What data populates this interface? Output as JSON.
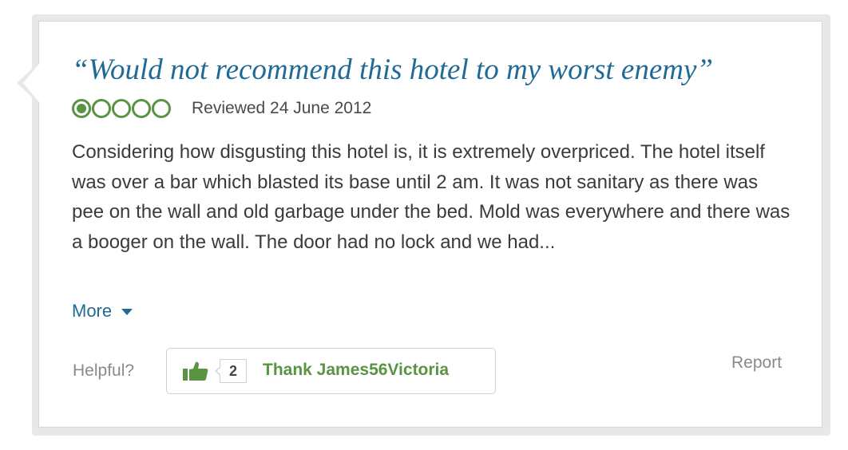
{
  "review": {
    "title": "“Would not recommend this hotel to my worst enemy”",
    "rating": 1,
    "rating_max": 5,
    "date_text": "Reviewed 24 June 2012",
    "body": "Considering how disgusting this hotel is, it is extremely overpriced. The hotel itself was over a bar which blasted its base until 2 am. It was not sanitary as there was pee on the wall and old garbage under the bed. Mold was everywhere and there was a booger on the wall. The door had no lock and we had...",
    "more_label": "More"
  },
  "footer": {
    "helpful_label": "Helpful?",
    "thank_count": "2",
    "thank_label": "Thank James56Victoria",
    "report_label": "Report"
  },
  "colors": {
    "title": "#1f6a96",
    "rating_green": "#589442",
    "body_text": "#3b3b3b",
    "muted": "#8a8a8a"
  },
  "icons": {
    "rating": "rating-bubble-icon",
    "more": "caret-down-icon",
    "thank": "thumbs-up-icon"
  }
}
